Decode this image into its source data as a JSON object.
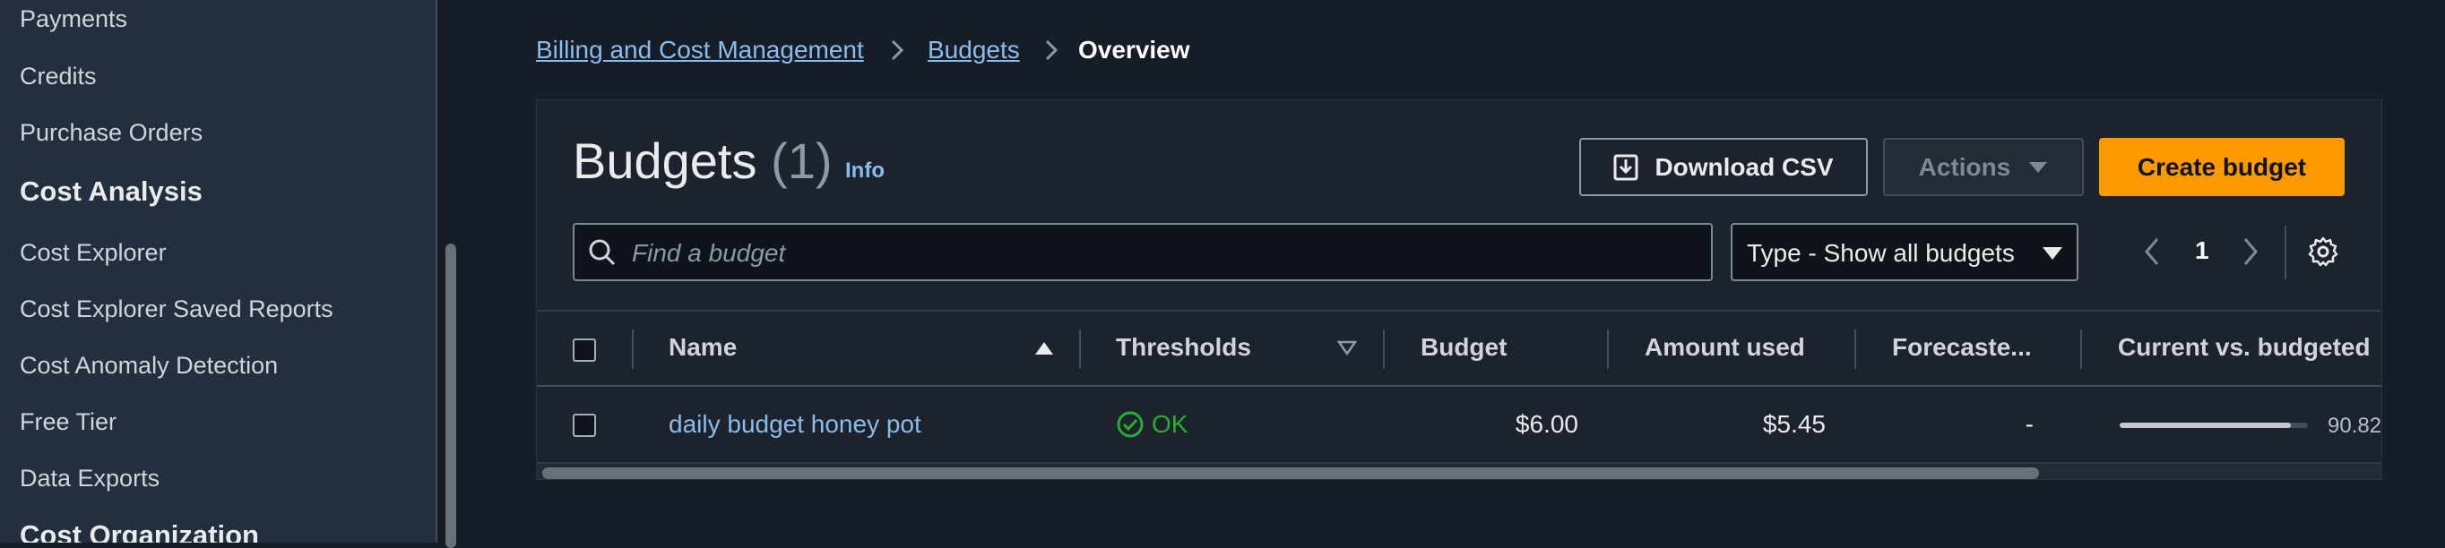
{
  "sidebar": {
    "items_top": [
      "Payments",
      "Credits",
      "Purchase Orders"
    ],
    "section_cost_analysis": "Cost Analysis",
    "items_analysis": [
      "Cost Explorer",
      "Cost Explorer Saved Reports",
      "Cost Anomaly Detection",
      "Free Tier",
      "Data Exports"
    ],
    "section_cost_organization": "Cost Organization"
  },
  "breadcrumb": {
    "billing": "Billing and Cost Management",
    "budgets": "Budgets",
    "current": "Overview"
  },
  "header": {
    "title": "Budgets",
    "count": "(1)",
    "info": "Info",
    "download_csv": "Download CSV",
    "actions": "Actions",
    "create_budget": "Create budget"
  },
  "filters": {
    "search_placeholder": "Find a budget",
    "type_select": "Type - Show all budgets"
  },
  "pagination": {
    "current_page": "1"
  },
  "table": {
    "columns": [
      "Name",
      "Thresholds",
      "Budget",
      "Amount used",
      "Forecaste...",
      "Current vs. budgeted"
    ],
    "rows": [
      {
        "name": "daily budget honey pot",
        "threshold_status": "OK",
        "budget": "$6.00",
        "amount_used": "$5.45",
        "forecasted": "-",
        "current_vs_budgeted": "90.82",
        "current_vs_budgeted_fraction": 0.9082
      }
    ]
  },
  "colors": {
    "accent_link": "#89bdee",
    "primary_button": "#ff9900",
    "ok_status": "#29ad32"
  }
}
